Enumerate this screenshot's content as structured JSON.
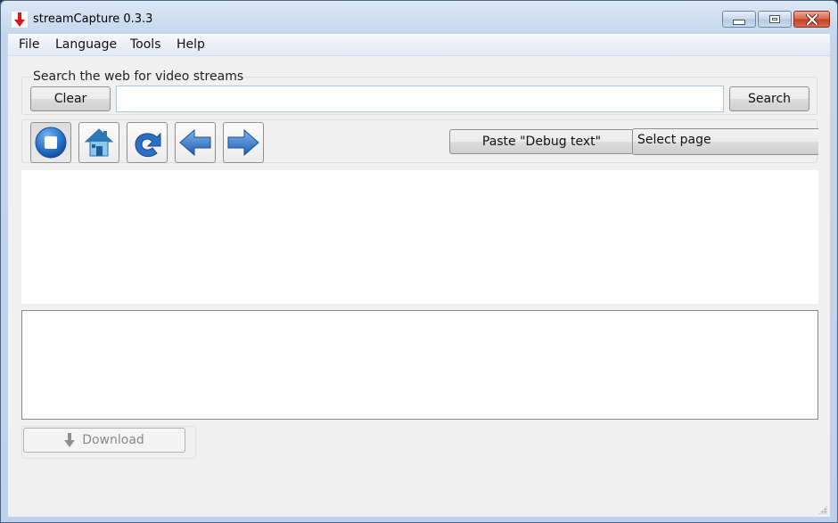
{
  "window": {
    "title": "streamCapture 0.3.3",
    "controls": {
      "minimize": "minimize-icon",
      "maximize": "maximize-icon",
      "close": "close-icon"
    }
  },
  "menubar": {
    "items": [
      {
        "label": "File"
      },
      {
        "label": "Language"
      },
      {
        "label": "Tools"
      },
      {
        "label": "Help"
      }
    ]
  },
  "search": {
    "group_title": "Search the web for video streams",
    "clear_label": "Clear",
    "query_value": "",
    "search_label": "Search"
  },
  "toolbar": {
    "buttons": [
      {
        "name": "stop",
        "icon": "stop-icon"
      },
      {
        "name": "home",
        "icon": "home-icon"
      },
      {
        "name": "reload",
        "icon": "reload-icon"
      },
      {
        "name": "back",
        "icon": "back-arrow-icon"
      },
      {
        "name": "forward",
        "icon": "forward-arrow-icon"
      }
    ],
    "paste_debug_label": "Paste \"Debug text\"",
    "select_page_value": "Select page"
  },
  "download": {
    "label": "Download",
    "enabled": false
  }
}
